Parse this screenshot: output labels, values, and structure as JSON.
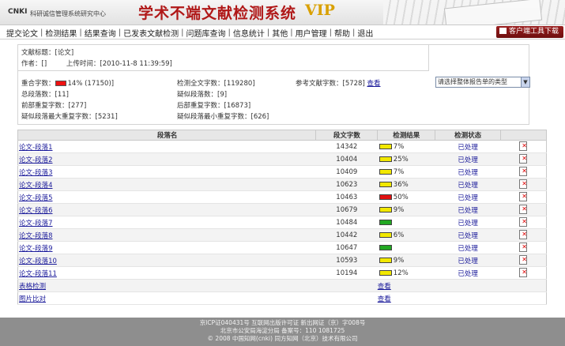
{
  "header": {
    "logo": "CNKI",
    "logo_subtitle": "科研诚信管理系统研究中心",
    "system_title": "学术不端文献检测系统",
    "vip": "VIP"
  },
  "nav": {
    "items": [
      "提交论文",
      "检测结果",
      "结果查询",
      "已发表文献检测",
      "问题库查询",
      "信息统计",
      "其他",
      "用户管理",
      "帮助",
      "退出"
    ],
    "client_tool": "客户端工具下载"
  },
  "doc": {
    "title_label": "文献标题：",
    "title_value": "[论文]",
    "author_label": "作者：",
    "author_value": "[]",
    "upload_label": "上传时间：",
    "upload_value": "[2010-11-8 11:39:59]"
  },
  "stats": {
    "dup_chars_label": "重合字数：",
    "dup_chars_value": "14% (17150)]",
    "total_chars_label": "检测全文字数：",
    "total_chars_value": "[119280]",
    "ref_chars_label": "参考文献字数：",
    "ref_chars_value": "[5728]",
    "view": "查看",
    "total_paras_label": "总段落数：",
    "total_paras_value": "[11]",
    "sus_paras_label": "疑似段落数：",
    "sus_paras_value": "[9]",
    "front_dup_label": "前部重复字数：",
    "front_dup_value": "[277]",
    "back_dup_label": "后部重复字数：",
    "back_dup_value": "[16873]",
    "max_dup_label": "疑似段落最大重复字数：",
    "max_dup_value": "[5231]",
    "min_dup_label": "疑似段落最小重复字数：",
    "min_dup_value": "[626]"
  },
  "report_select": {
    "selected": "请选择整体报告单的类型"
  },
  "table": {
    "headers": [
      "段落名",
      "段文字数",
      "检测结果",
      "检测状态",
      ""
    ],
    "rows": [
      {
        "name": "论文-段落1",
        "count": "14342",
        "color": "#f2e800",
        "pct": "7%",
        "status": "已处理"
      },
      {
        "name": "论文-段落2",
        "count": "10404",
        "color": "#f2e800",
        "pct": "25%",
        "status": "已处理"
      },
      {
        "name": "论文-段落3",
        "count": "10409",
        "color": "#f2e800",
        "pct": "7%",
        "status": "已处理"
      },
      {
        "name": "论文-段落4",
        "count": "10623",
        "color": "#f2e800",
        "pct": "36%",
        "status": "已处理"
      },
      {
        "name": "论文-段落5",
        "count": "10463",
        "color": "#e01010",
        "pct": "50%",
        "status": "已处理"
      },
      {
        "name": "论文-段落6",
        "count": "10679",
        "color": "#f2e800",
        "pct": "9%",
        "status": "已处理"
      },
      {
        "name": "论文-段落7",
        "count": "10484",
        "color": "#22a822",
        "pct": "",
        "status": "已处理"
      },
      {
        "name": "论文-段落8",
        "count": "10442",
        "color": "#f2e800",
        "pct": "6%",
        "status": "已处理"
      },
      {
        "name": "论文-段落9",
        "count": "10647",
        "color": "#22a822",
        "pct": "",
        "status": "已处理"
      },
      {
        "name": "论文-段落10",
        "count": "10593",
        "color": "#f2e800",
        "pct": "9%",
        "status": "已处理"
      },
      {
        "name": "论文-段落11",
        "count": "10194",
        "color": "#f2e800",
        "pct": "12%",
        "status": "已处理"
      }
    ],
    "extra_rows": [
      {
        "name": "表格检测",
        "action": "查看"
      },
      {
        "name": "图片比对",
        "action": "查看"
      }
    ]
  },
  "footer": {
    "line1": "京ICP证040431号  互联网出版许可证  新出网证（京）字008号",
    "line2": "北京市公安局海淀分局 备案号：110 1081725",
    "line3": "© 2008 中国知网(cnki) 同方知网（北京）技术有限公司"
  }
}
